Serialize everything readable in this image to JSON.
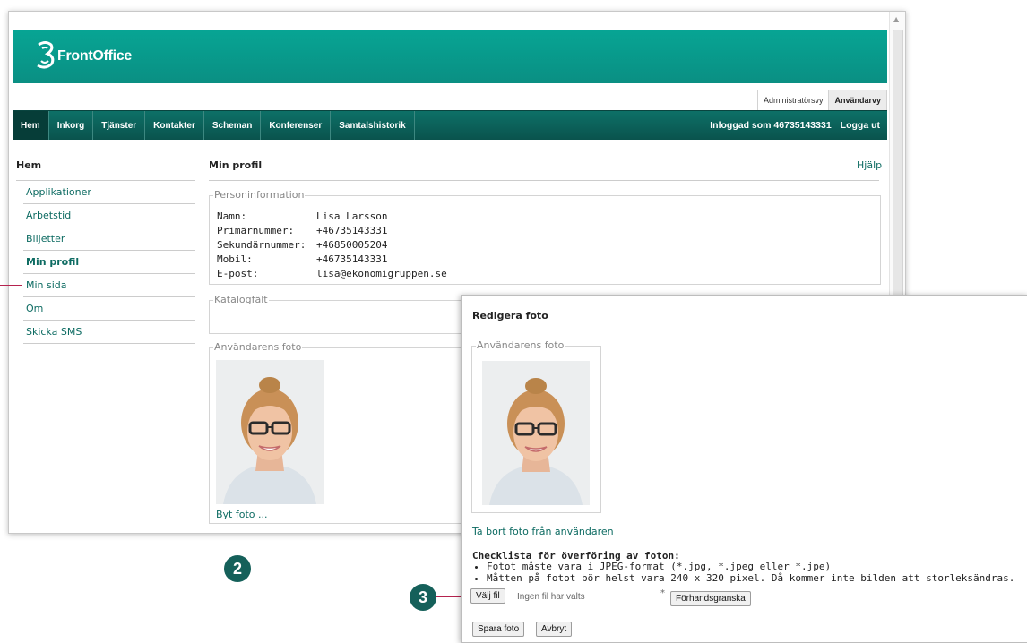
{
  "app": {
    "logo_text": "FrontOffice",
    "brand_color": "#0a9b8c",
    "nav_color": "#0b5f57",
    "link_color": "#0d6b62"
  },
  "view_switch": {
    "admin": "Administratörsvy",
    "user": "Användarvy"
  },
  "nav": {
    "items": [
      {
        "label": "Hem"
      },
      {
        "label": "Inkorg"
      },
      {
        "label": "Tjänster"
      },
      {
        "label": "Kontakter"
      },
      {
        "label": "Scheman"
      },
      {
        "label": "Konferenser"
      },
      {
        "label": "Samtalshistorik"
      }
    ],
    "logged_in": "Inloggad som 46735143331",
    "logout": "Logga ut"
  },
  "sidebar": {
    "title": "Hem",
    "items": [
      {
        "label": "Applikationer"
      },
      {
        "label": "Arbetstid"
      },
      {
        "label": "Biljetter"
      },
      {
        "label": "Min profil"
      },
      {
        "label": "Min sida"
      },
      {
        "label": "Om"
      },
      {
        "label": "Skicka SMS"
      }
    ]
  },
  "main": {
    "title": "Min profil",
    "help": "Hjälp",
    "person_legend": "Personinformation",
    "person": [
      {
        "label": "Namn:",
        "value": "Lisa Larsson"
      },
      {
        "label": "Primärnummer:",
        "value": "+46735143331"
      },
      {
        "label": "Sekundärnummer:",
        "value": "+46850005204"
      },
      {
        "label": "Mobil:",
        "value": "+46735143331"
      },
      {
        "label": "E-post:",
        "value": "lisa@ekonomigruppen.se"
      }
    ],
    "catalog_legend": "Katalogfält",
    "photo_legend": "Användarens foto",
    "change_photo": "Byt foto ..."
  },
  "modal": {
    "title": "Redigera foto",
    "photo_legend": "Användarens foto",
    "remove_link": "Ta bort foto från användaren",
    "checklist_title": "Checklista för överföring av foton:",
    "checklist": [
      "Fotot måste vara i JPEG-format (*.jpg, *.jpeg eller *.jpe)",
      "Måtten på fotot bör helst vara 240 x 320 pixel. Då kommer inte bilden att storleksändras."
    ],
    "file_button": "Välj fil",
    "file_status": "Ingen fil har valts",
    "asterisk": "*",
    "preview_button": "Förhandsgranska",
    "save_button": "Spara foto",
    "cancel_button": "Avbryt"
  },
  "callouts": {
    "two": "2",
    "three": "3",
    "line_color": "#b5224e"
  }
}
